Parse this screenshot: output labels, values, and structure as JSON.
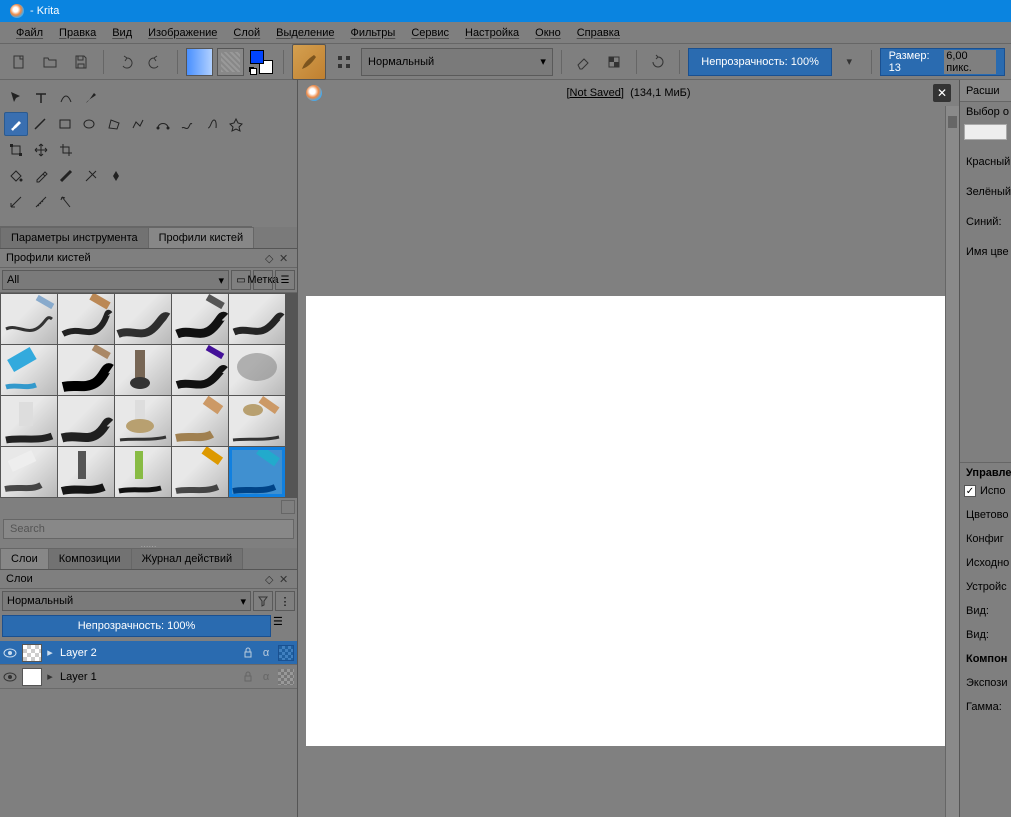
{
  "app": {
    "title": "- Krita"
  },
  "menu": [
    "Файл",
    "Правка",
    "Вид",
    "Изображение",
    "Слой",
    "Выделение",
    "Фильтры",
    "Сервис",
    "Настройка",
    "Окно",
    "Справка"
  ],
  "toolbar": {
    "blend_mode": "Нормальный",
    "opacity_label": "Непрозрачность: 100%",
    "size_label": "Размер: 13",
    "size_suffix": "6,00 пикс."
  },
  "dock": {
    "tool_options_tab": "Параметры инструмента",
    "brush_presets_tab": "Профили кистей",
    "brush_presets_title": "Профили кистей",
    "preset_filter": "All",
    "preset_tag_btn": "Метка",
    "search_placeholder": "Search"
  },
  "layers_dock": {
    "tabs": [
      "Слои",
      "Композиции",
      "Журнал действий"
    ],
    "title": "Слои",
    "blend_mode": "Нормальный",
    "opacity_label": "Непрозрачность:  100%",
    "layers": [
      {
        "name": "Layer 2",
        "selected": true,
        "checker_thumb": true,
        "alpha_checker": true
      },
      {
        "name": "Layer 1",
        "selected": false,
        "checker_thumb": false,
        "alpha_checker": false
      }
    ]
  },
  "canvas": {
    "doc_title_underlined": "Not Saved",
    "doc_info": "(134,1 МиБ)"
  },
  "right": {
    "tab1": "Расши",
    "sec1_title": "Выбор о",
    "red": "Красный",
    "green": "Зелёный",
    "blue": "Синий:",
    "colorname": "Имя цве",
    "sec2_title": "Управле",
    "use_label": "Испо",
    "colorspace": "Цветово",
    "config": "Конфиг",
    "source": "Исходно",
    "device": "Устройс",
    "view1": "Вид:",
    "view2": "Вид:",
    "components": "Компон",
    "exposure": "Экспози",
    "gamma": "Гамма:"
  }
}
